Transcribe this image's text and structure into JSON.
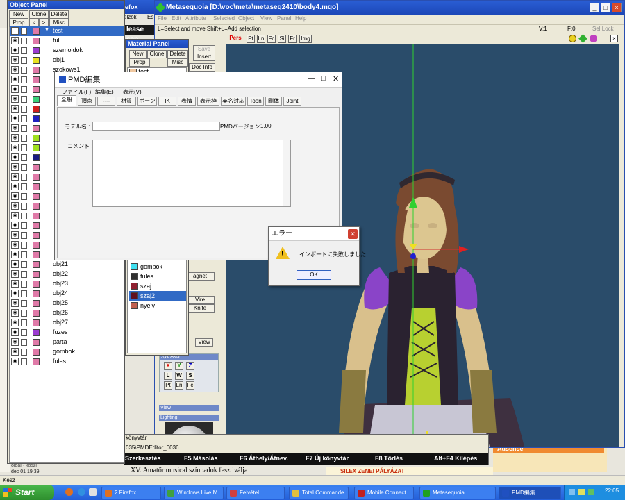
{
  "browser_window": {
    "title": "efox",
    "menu_items": [
      "elzők",
      "Es"
    ],
    "banner_text": "lease can",
    "statusbar": "Kész",
    "news_line": "XV. Amatőr musical színpadok fesztiválja",
    "news_meta": "oldal · köszi",
    "news_date": "dec 01 19:39",
    "silex_text": "SILEX ZENEI PÁLYÁZAT",
    "adsense": "Adsense"
  },
  "object_panel": {
    "title": "Object Panel",
    "buttons": [
      "New",
      "Clone",
      "Delete",
      "Prop",
      "<",
      ">",
      "Misc"
    ],
    "objects": [
      {
        "name": "test",
        "color": "#e07aa8",
        "selected": true
      },
      {
        "name": "ful",
        "color": "#e07aa8"
      },
      {
        "name": "szemoldok",
        "color": "#9b3bd0"
      },
      {
        "name": "obj1",
        "color": "#e8e020"
      },
      {
        "name": "szokows1",
        "color": "#e07aa8"
      },
      {
        "name": "",
        "color": "#e07aa8"
      },
      {
        "name": "",
        "color": "#e07aa8"
      },
      {
        "name": "",
        "color": "#3ad07a"
      },
      {
        "name": "",
        "color": "#d02020"
      },
      {
        "name": "",
        "color": "#2020c0"
      },
      {
        "name": "",
        "color": "#e07aa8"
      },
      {
        "name": "",
        "color": "#a0e020"
      },
      {
        "name": "",
        "color": "#a0e020"
      },
      {
        "name": "",
        "color": "#1a1a80"
      },
      {
        "name": "",
        "color": "#e07aa8"
      },
      {
        "name": "",
        "color": "#e07aa8"
      },
      {
        "name": "",
        "color": "#e07aa8"
      },
      {
        "name": "",
        "color": "#e07aa8"
      },
      {
        "name": "",
        "color": "#e07aa8"
      },
      {
        "name": "",
        "color": "#e07aa8"
      },
      {
        "name": "",
        "color": "#e07aa8"
      },
      {
        "name": "",
        "color": "#e07aa8"
      },
      {
        "name": "",
        "color": "#e07aa8"
      },
      {
        "name": "",
        "color": "#e07aa8"
      },
      {
        "name": "obj21",
        "color": "#e07aa8"
      },
      {
        "name": "obj22",
        "color": "#e07aa8"
      },
      {
        "name": "obj23",
        "color": "#e07aa8"
      },
      {
        "name": "obj24",
        "color": "#e07aa8"
      },
      {
        "name": "obj25",
        "color": "#e07aa8"
      },
      {
        "name": "obj26",
        "color": "#e07aa8"
      },
      {
        "name": "obj27",
        "color": "#e07aa8"
      },
      {
        "name": "fuzes",
        "color": "#9b3bd0"
      },
      {
        "name": "parta",
        "color": "#e07aa8"
      },
      {
        "name": "gombok",
        "color": "#e07aa8"
      },
      {
        "name": "fules",
        "color": "#e07aa8"
      }
    ]
  },
  "material_panel": {
    "title": "Material Panel",
    "buttons": [
      "New",
      "Clone",
      "Delete",
      "Prop",
      "Misc"
    ],
    "first_item": "test",
    "materials": [
      {
        "name": "gombok",
        "color": "#40e0f0"
      },
      {
        "name": "fules",
        "color": "#303030"
      },
      {
        "name": "szaj",
        "color": "#902030"
      },
      {
        "name": "szaj2",
        "color": "#601020",
        "selected": true
      },
      {
        "name": "nyelv",
        "color": "#c06050"
      }
    ]
  },
  "metasequoia": {
    "title": "Metasequoia [D:\\voc\\meta\\metaseq2410\\body4.mqo]",
    "menu": [
      "File",
      "Edit",
      "Attribute",
      "Selected",
      "Object",
      "View",
      "Panel",
      "Help"
    ],
    "hint": "L=Select and move  Shift+L=Add selection",
    "vertex_count": "V:1",
    "face_count": "F:0",
    "sel_lock": "Sel Lock",
    "view_buttons": [
      "Pers",
      "Pt",
      "Ln",
      "Fc",
      "Si",
      "Fr",
      "Img"
    ],
    "command_labels": [
      "Save",
      "Insert",
      "Doc Info",
      "agnet",
      "Vire",
      "Knife",
      "View",
      "Xyz Axis"
    ],
    "axis_buttons": [
      "X",
      "Y",
      "Z",
      "L",
      "W",
      "S",
      "Pt",
      "Ln",
      "Fc"
    ],
    "view_label": "View",
    "lighting_label": "Lighting"
  },
  "pmd_editor": {
    "title": "PMD編集",
    "menu": [
      "ファイル(F)",
      "編集(E)",
      "表示(V)"
    ],
    "tabs": [
      "全般",
      "頂点",
      "----",
      "材質",
      "ボーン",
      "IK",
      "表情",
      "表示枠",
      "英名対応",
      "Toon",
      "剛体",
      "Joint"
    ],
    "model_name_label": "モデル名 :",
    "model_name_value": "",
    "version_label": "PMDバージョン",
    "version_value": "1,00",
    "comment_label": "コメント :",
    "comment_value": ""
  },
  "error_dialog": {
    "title": "エラー",
    "message": "インポートに失敗しました",
    "ok_label": "OK"
  },
  "commander": {
    "path_1": "könyvtár",
    "path_2": "035\\PMDEditor_0036",
    "fkeys": [
      "Szerkesztés",
      "F5 Másolás",
      "F6 Áthely/Átnev.",
      "F7 Új könyvtár",
      "F8 Törlés",
      "Alt+F4 Kilépés"
    ]
  },
  "taskbar": {
    "start": "Start",
    "clock": "22:05",
    "tasks": [
      {
        "label": "2 Firefox",
        "icon": "firefox-icon",
        "color": "#e07020"
      },
      {
        "label": "Windows Live M...",
        "icon": "messenger-icon",
        "color": "#40a040"
      },
      {
        "label": "Felvétel",
        "icon": "recorder-icon",
        "color": "#d04040"
      },
      {
        "label": "Total Commande...",
        "icon": "total-commander-icon",
        "color": "#e0c040"
      },
      {
        "label": "Mobile Connect",
        "icon": "mobile-connect-icon",
        "color": "#c02020"
      },
      {
        "label": "Metasequoia",
        "icon": "metasequoia-icon",
        "color": "#20a020"
      },
      {
        "label": "PMD編集",
        "icon": "pmd-editor-icon",
        "color": "#2050c0",
        "active": true
      }
    ]
  }
}
